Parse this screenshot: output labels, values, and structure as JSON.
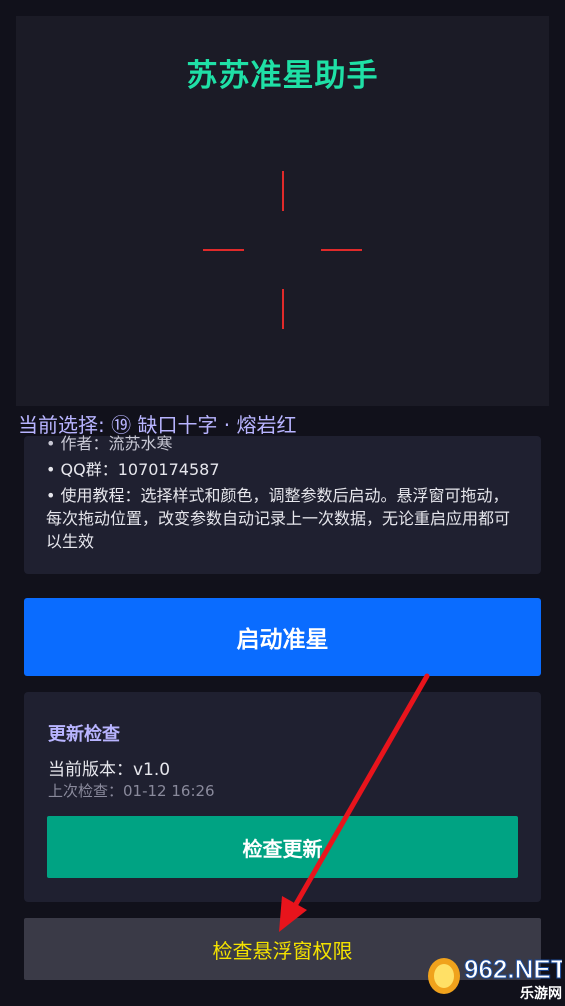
{
  "app": {
    "title": "苏苏准星助手"
  },
  "selection": {
    "text": "当前选择: ⑲ 缺口十字 · 熔岩红"
  },
  "info": {
    "author": "• 作者：流苏水寒",
    "qq_group": "• QQ群：1070174587",
    "tutorial": "• 使用教程：选择样式和颜色，调整参数后启动。悬浮窗可拖动，每次拖动位置，改变参数自动记录上一次数据，无论重启应用都可以生效"
  },
  "actions": {
    "start_label": "启动准星",
    "check_update_label": "检查更新",
    "check_permission_label": "检查悬浮窗权限"
  },
  "update": {
    "title": "更新检查",
    "current_version": "当前版本：v1.0",
    "last_check": "上次检查：01-12 16:26"
  },
  "watermark": {
    "brand": "962.NET",
    "subtitle": "乐游网"
  },
  "colors": {
    "title_green": "#1fe0a6",
    "crosshair_red": "#e02a2a",
    "start_blue": "#0a6cff",
    "update_green": "#00a383",
    "permission_yellow": "#f4e200",
    "arrow_red": "#e8141c"
  }
}
